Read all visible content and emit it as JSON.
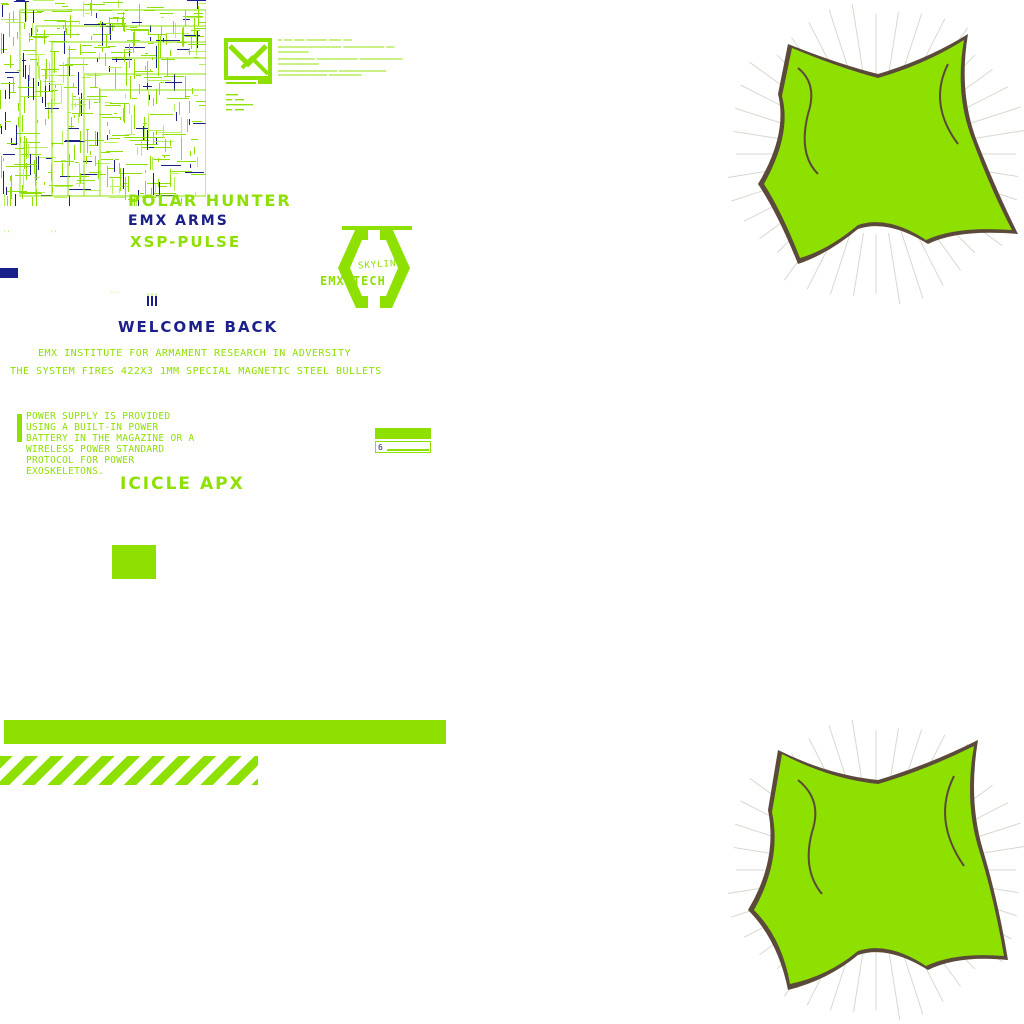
{
  "header": {
    "line1": "POLAR HUNTER",
    "line2": "EMX ARMS",
    "line3": "XSP-PULSE"
  },
  "logo": {
    "top": "SKYLINE",
    "bottom": "EMX TECH"
  },
  "welcome": "WELCOME BACK",
  "institute": "EMX INSTITUTE FOR ARMAMENT RESEARCH IN ADVERSITY",
  "fires": "THE SYSTEM FIRES 422X3 1MM SPECIAL MAGNETIC STEEL BULLETS",
  "power": "POWER SUPPLY IS PROVIDED USING A BUILT-IN POWER BATTERY IN THE MAGAZINE OR A WIRELESS POWER STANDARD PROTOCOL FOR POWER EXOSKELETONS.",
  "model": "ICICLE APX",
  "indicator": {
    "label": "6"
  },
  "colors": {
    "accent": "#8ee000",
    "navy": "#1a1f8a",
    "splash_shadow": "#5b4a3a"
  },
  "icons": [
    "emx-emblem-icon",
    "ammo-icon",
    "splash-graphic"
  ]
}
